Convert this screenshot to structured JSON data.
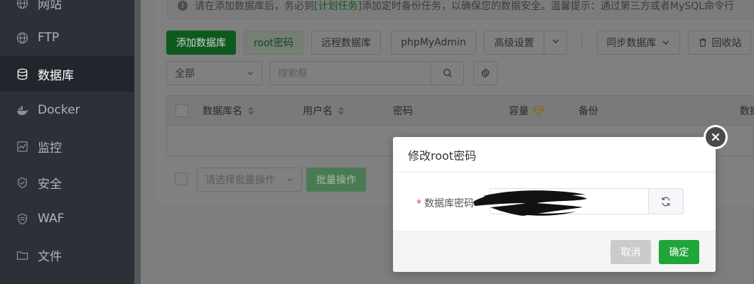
{
  "sidebar": {
    "items": [
      {
        "label": "网站",
        "icon": "globe-icon"
      },
      {
        "label": "FTP",
        "icon": "globe-icon"
      },
      {
        "label": "数据库",
        "icon": "database-icon",
        "active": true
      },
      {
        "label": "Docker",
        "icon": "docker-icon"
      },
      {
        "label": "监控",
        "icon": "monitor-icon"
      },
      {
        "label": "安全",
        "icon": "shield-icon"
      },
      {
        "label": "WAF",
        "icon": "waf-shield-icon"
      },
      {
        "label": "文件",
        "icon": "folder-icon"
      }
    ]
  },
  "alert": {
    "text_before": "请在添加数据库后，务必到",
    "link": "[计划任务]",
    "text_after": "添加定时备份任务，以确保您的数据安全。温馨提示：通过第三方或者MySQL命令行"
  },
  "toolbar": {
    "add_db": "添加数据库",
    "root_pwd": "root密码",
    "remote_db": "远程数据库",
    "phpmyadmin": "phpMyAdmin",
    "advanced": "高级设置",
    "sync_db": "同步数据库",
    "recycle": "回收站"
  },
  "filter": {
    "select_value": "全部",
    "search_placeholder": "搜索框"
  },
  "table": {
    "headers": {
      "name": "数据库名",
      "user": "用户名",
      "password": "密码",
      "capacity": "容量",
      "backup": "备份",
      "extra": "数据"
    }
  },
  "bulk": {
    "select_placeholder": "请选择批量操作",
    "button": "批量操作"
  },
  "modal": {
    "title": "修改root密码",
    "field_label": "数据库密码",
    "required_mark": "*",
    "cancel": "取消",
    "confirm": "确定"
  },
  "colors": {
    "accent": "#20a53a",
    "sidebar": "#2c3138"
  }
}
